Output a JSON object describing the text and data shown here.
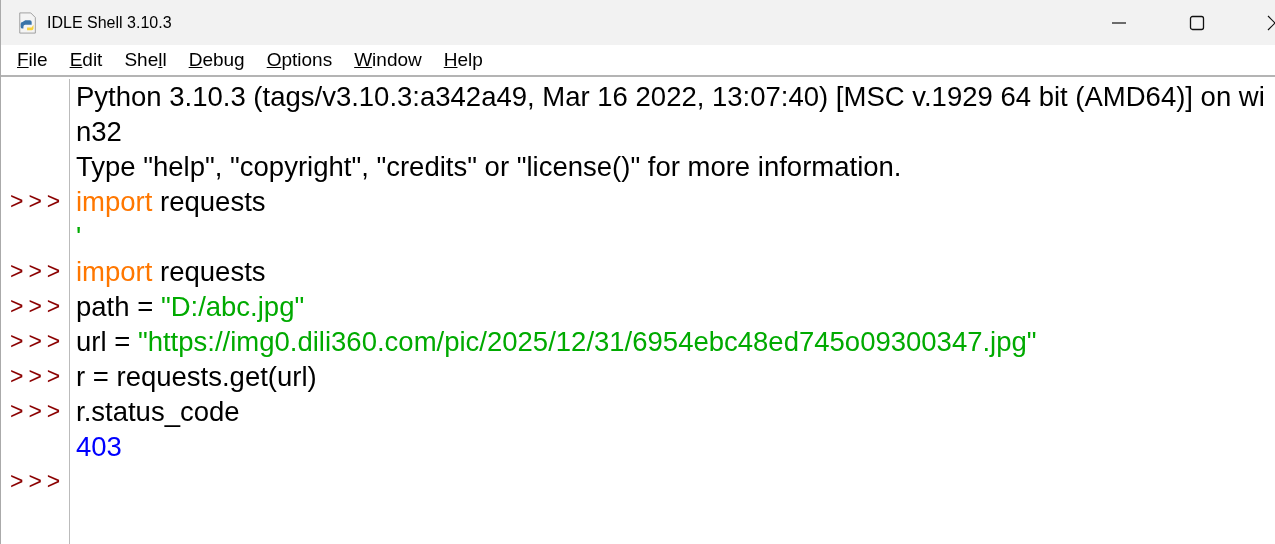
{
  "window": {
    "title": "IDLE Shell 3.10.3"
  },
  "menu": [
    {
      "key": "F",
      "post": "ile"
    },
    {
      "key": "E",
      "post": "dit"
    },
    {
      "pre": "She",
      "key": "l",
      "post": "l"
    },
    {
      "key": "D",
      "post": "ebug"
    },
    {
      "key": "O",
      "post": "ptions"
    },
    {
      "key": "W",
      "post": "indow"
    },
    {
      "key": "H",
      "post": "elp"
    }
  ],
  "lines": [
    {
      "segments": [
        {
          "kind": "output",
          "text": "Python 3.10.3 (tags/v3.10.3:a342a49, Mar 16 2022, 13:07:40) [MSC v.1929 64 bit (AMD64)] on wi"
        }
      ]
    },
    {
      "segments": [
        {
          "kind": "output",
          "text": "n32"
        }
      ]
    },
    {
      "segments": [
        {
          "kind": "output",
          "text": "Type \"help\", \"copyright\", \"credits\" or \"license()\" for more information."
        }
      ]
    },
    {
      "prompt": ">>>",
      "segments": [
        {
          "kind": "keyword",
          "text": "import"
        },
        {
          "kind": "plain",
          "text": " requests"
        }
      ]
    },
    {
      "segments": [
        {
          "kind": "string",
          "text": "'"
        }
      ]
    },
    {
      "prompt": ">>>",
      "segments": [
        {
          "kind": "keyword",
          "text": "import"
        },
        {
          "kind": "plain",
          "text": " requests"
        }
      ]
    },
    {
      "prompt": ">>>",
      "segments": [
        {
          "kind": "plain",
          "text": "path = "
        },
        {
          "kind": "string",
          "text": "\"D:/abc.jpg\""
        }
      ]
    },
    {
      "prompt": ">>>",
      "segments": [
        {
          "kind": "plain",
          "text": "url = "
        },
        {
          "kind": "string",
          "text": "\"https://img0.dili360.com/pic/2025/12/31/6954ebc48ed745o09300347.jpg\""
        }
      ]
    },
    {
      "prompt": ">>>",
      "segments": [
        {
          "kind": "plain",
          "text": "r = requests.get(url)"
        }
      ]
    },
    {
      "prompt": ">>>",
      "segments": [
        {
          "kind": "plain",
          "text": "r.status_code"
        }
      ]
    },
    {
      "segments": [
        {
          "kind": "result",
          "text": "403"
        }
      ]
    },
    {
      "prompt": ">>>"
    }
  ]
}
